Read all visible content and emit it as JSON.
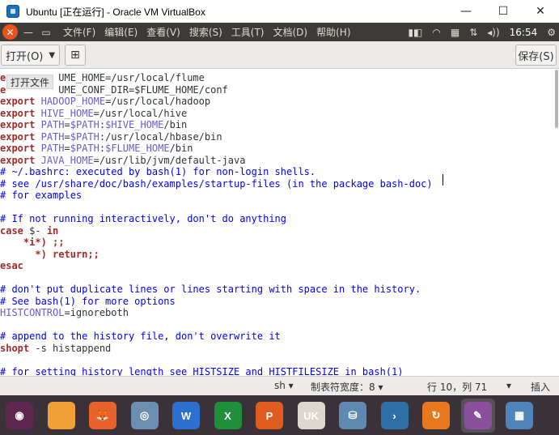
{
  "window": {
    "title": "Ubuntu [正在运行] - Oracle VM VirtualBox",
    "minimize": "—",
    "maximize": "☐",
    "close": "✕"
  },
  "panel": {
    "close_symbol": "✕",
    "minimize_symbol": "—",
    "restore_symbol": "▭",
    "menus": [
      "文件(F)",
      "编辑(E)",
      "查看(V)",
      "搜索(S)",
      "工具(T)",
      "文档(D)",
      "帮助(H)"
    ],
    "indicator_icons": [
      "input-method-icon",
      "wifi-icon",
      "keyboard-icon",
      "network-transfer-icon",
      "volume-icon"
    ],
    "clock": "16:54",
    "power_symbol": "⚙"
  },
  "toolbar": {
    "open_label": "打开(O)",
    "new_tab_symbol": "⊞",
    "save_label": "保存(S)"
  },
  "editor": {
    "tooltip": "打开文件",
    "lines": [
      [
        {
          "t": "e",
          "c": "kw"
        },
        {
          "t": "         UME_HOME=/usr/local/flume",
          "c": "str"
        }
      ],
      [
        {
          "t": "e",
          "c": "kw"
        },
        {
          "t": "         UME_CONF_DIR=$FLUME_HOME/conf",
          "c": "str"
        }
      ],
      [
        {
          "t": "export",
          "c": "kw"
        },
        {
          "t": " ",
          "c": "str"
        },
        {
          "t": "HADOOP_HOME",
          "c": "var"
        },
        {
          "t": "=/usr/local/hadoop",
          "c": "str"
        }
      ],
      [
        {
          "t": "export",
          "c": "kw"
        },
        {
          "t": " ",
          "c": "str"
        },
        {
          "t": "HIVE_HOME",
          "c": "var"
        },
        {
          "t": "=/usr/local/hive",
          "c": "str"
        }
      ],
      [
        {
          "t": "export",
          "c": "kw"
        },
        {
          "t": " ",
          "c": "str"
        },
        {
          "t": "PATH",
          "c": "var"
        },
        {
          "t": "=",
          "c": "str"
        },
        {
          "t": "$PATH",
          "c": "var"
        },
        {
          "t": ":",
          "c": "str"
        },
        {
          "t": "$HIVE_HOME",
          "c": "var"
        },
        {
          "t": "/bin",
          "c": "str"
        }
      ],
      [
        {
          "t": "export",
          "c": "kw"
        },
        {
          "t": " ",
          "c": "str"
        },
        {
          "t": "PATH",
          "c": "var"
        },
        {
          "t": "=",
          "c": "str"
        },
        {
          "t": "$PATH",
          "c": "var"
        },
        {
          "t": ":/usr/local/hbase/bin",
          "c": "str"
        }
      ],
      [
        {
          "t": "export",
          "c": "kw"
        },
        {
          "t": " ",
          "c": "str"
        },
        {
          "t": "PATH",
          "c": "var"
        },
        {
          "t": "=",
          "c": "str"
        },
        {
          "t": "$PATH",
          "c": "var"
        },
        {
          "t": ":",
          "c": "str"
        },
        {
          "t": "$FLUME_HOME",
          "c": "var"
        },
        {
          "t": "/bin",
          "c": "str"
        }
      ],
      [
        {
          "t": "export",
          "c": "kw"
        },
        {
          "t": " ",
          "c": "str"
        },
        {
          "t": "JAVA_HOME",
          "c": "var"
        },
        {
          "t": "=/usr/lib/jvm/default-java",
          "c": "str"
        }
      ],
      [
        {
          "t": "# ~/.bashrc: executed by bash(1) for non-login shells.",
          "c": "cmt"
        }
      ],
      [
        {
          "t": "# see /usr/share/doc/bash/examples/startup-files (in the package bash-doc)",
          "c": "cmt"
        }
      ],
      [
        {
          "t": "# for examples",
          "c": "cmt"
        }
      ],
      [],
      [
        {
          "t": "# If not running interactively, don't do anything",
          "c": "cmt"
        }
      ],
      [
        {
          "t": "case",
          "c": "kw"
        },
        {
          "t": " $- ",
          "c": "str"
        },
        {
          "t": "in",
          "c": "kw"
        }
      ],
      [
        {
          "t": "    *i*) ;;",
          "c": "kw"
        }
      ],
      [
        {
          "t": "      *) return;;",
          "c": "kw"
        }
      ],
      [
        {
          "t": "esac",
          "c": "kw"
        }
      ],
      [],
      [
        {
          "t": "# don't put duplicate lines or lines starting with space in the history.",
          "c": "cmt"
        }
      ],
      [
        {
          "t": "# See bash(1) for more options",
          "c": "cmt"
        }
      ],
      [
        {
          "t": "HISTCONTROL",
          "c": "var"
        },
        {
          "t": "=ignoreboth",
          "c": "str"
        }
      ],
      [],
      [
        {
          "t": "# append to the history file, don't overwrite it",
          "c": "cmt"
        }
      ],
      [
        {
          "t": "shopt",
          "c": "kw"
        },
        {
          "t": " -s histappend",
          "c": "str"
        }
      ],
      [],
      [
        {
          "t": "# for setting history length see HISTSIZE and HISTFILESIZE in bash(1)",
          "c": "cmt"
        }
      ]
    ]
  },
  "statusbar": {
    "language": "sh ▾",
    "tab_width": "制表符宽度：8 ▾",
    "position": "行 10，列 71",
    "position_arrow": "▾",
    "insert_mode": "插入"
  },
  "dock": {
    "items": [
      {
        "name": "ubuntu-logo-icon",
        "color": "#5e2750",
        "glyph": "◉"
      },
      {
        "name": "files-icon",
        "color": "#f0a035",
        "glyph": ""
      },
      {
        "name": "firefox-icon",
        "color": "#e8632b",
        "glyph": "🦊"
      },
      {
        "name": "browser-icon",
        "color": "#6b8fb0",
        "glyph": "◎"
      },
      {
        "name": "writer-icon",
        "color": "#2b6fcf",
        "glyph": "W"
      },
      {
        "name": "spreadsheet-icon",
        "color": "#1f8f3a",
        "glyph": "X"
      },
      {
        "name": "presentation-icon",
        "color": "#e05b1e",
        "glyph": "P"
      },
      {
        "name": "software-center-icon",
        "color": "#dcd6cc",
        "glyph": "UK"
      },
      {
        "name": "disk-icon",
        "color": "#5f89b0",
        "glyph": "⛁"
      },
      {
        "name": "terminal-icon",
        "color": "#2f6fa8",
        "glyph": "›"
      },
      {
        "name": "update-icon",
        "color": "#e7781e",
        "glyph": "↻"
      },
      {
        "name": "text-editor-icon",
        "color": "#8a4f9d",
        "glyph": "✎"
      },
      {
        "name": "apps-grid-icon",
        "color": "#4f83b9",
        "glyph": "▦"
      }
    ],
    "active_index": 11
  }
}
